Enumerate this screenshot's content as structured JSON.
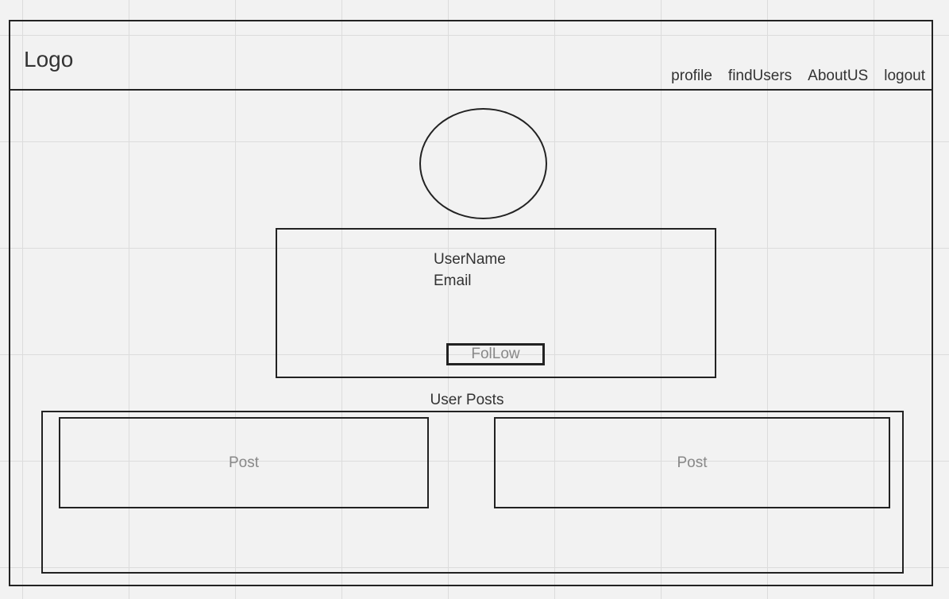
{
  "header": {
    "logo": "Logo",
    "nav": [
      "profile",
      "findUsers",
      "AboutUS",
      "logout"
    ]
  },
  "profile": {
    "username": "UserName",
    "email": "Email",
    "follow_label": "FolLow"
  },
  "posts": {
    "title": "User Posts",
    "items": [
      "Post",
      "Post"
    ]
  }
}
